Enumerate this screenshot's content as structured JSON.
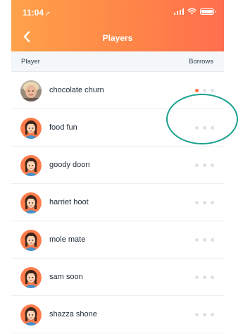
{
  "status_bar": {
    "time": "11:04",
    "location_arrow": "location-arrow-icon"
  },
  "header": {
    "title": "Players",
    "back_icon": "chevron-left-icon"
  },
  "columns": {
    "player": "Player",
    "borrows": "Borrows"
  },
  "players": [
    {
      "name": "chocolate churn",
      "avatar": "photo",
      "borrows_filled": 1
    },
    {
      "name": "food fun",
      "avatar": "cartoon",
      "borrows_filled": 0
    },
    {
      "name": "goody doon",
      "avatar": "cartoon",
      "borrows_filled": 0
    },
    {
      "name": "harriet hoot",
      "avatar": "cartoon",
      "borrows_filled": 0
    },
    {
      "name": "mole mate",
      "avatar": "cartoon",
      "borrows_filled": 0
    },
    {
      "name": "sam soon",
      "avatar": "cartoon",
      "borrows_filled": 0
    },
    {
      "name": "shazza shone",
      "avatar": "cartoon",
      "borrows_filled": 0
    }
  ],
  "borrows_max": 3,
  "colors": {
    "header_start": "#ffa24a",
    "header_end": "#ff6e4e",
    "dot_active": "#ff7043",
    "dot_inactive": "#dde1e5",
    "annotation": "#1aa18e"
  }
}
